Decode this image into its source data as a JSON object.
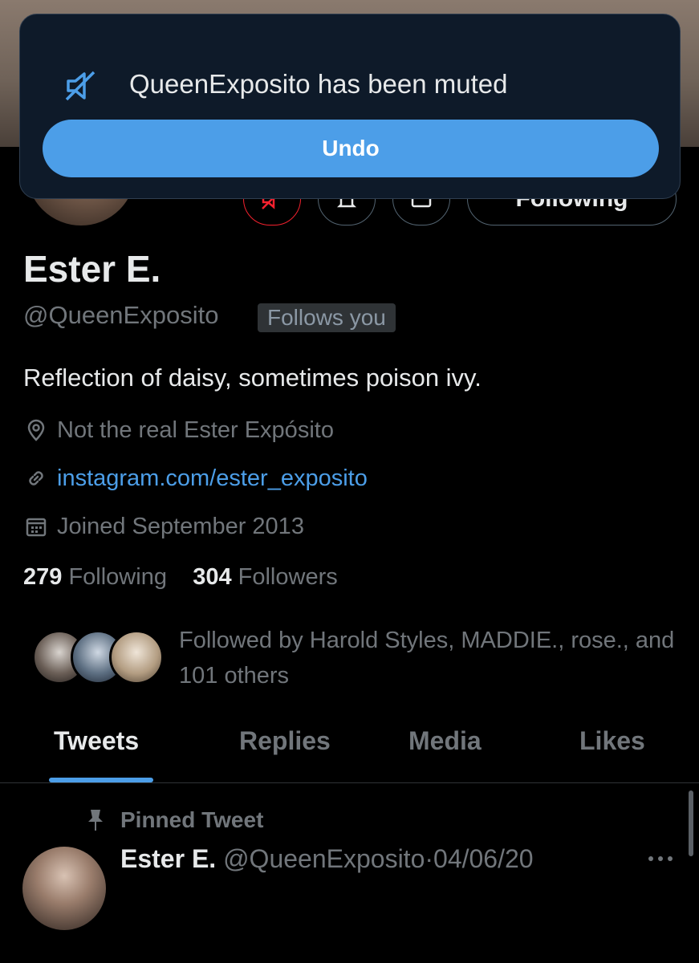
{
  "toast": {
    "icon": "mute-speaker-icon",
    "message": "QueenExposito has been muted",
    "undo_label": "Undo"
  },
  "header": {
    "following_label": "Following",
    "action_icons": [
      "muted-icon",
      "notification-bell-icon",
      "message-icon"
    ]
  },
  "profile": {
    "name": "Ester E.",
    "handle": "@QueenExposito",
    "follows_you": "Follows you",
    "bio": "Reflection of daisy, sometimes poison ivy.",
    "location": "Not the real Ester Expósito",
    "website": "instagram.com/ester_exposito",
    "joined": "Joined September 2013",
    "following_count": "279",
    "following_label": "Following",
    "followers_count": "304",
    "followers_label": "Followers",
    "followed_by": "Followed by Harold Styles, MADDIE., rose., and 101 others"
  },
  "tabs": [
    {
      "label": "Tweets",
      "active": true
    },
    {
      "label": "Replies",
      "active": false
    },
    {
      "label": "Media",
      "active": false
    },
    {
      "label": "Likes",
      "active": false
    }
  ],
  "pinned_tweet": {
    "pinned_label": "Pinned Tweet",
    "name": "Ester E.",
    "handle": "@QueenExposito",
    "separator": "·",
    "date": "04/06/20"
  },
  "colors": {
    "accent": "#4c9ee8",
    "background": "#000000",
    "muted_text": "#71767b",
    "toast_bg": "#0e1a29",
    "mute_red": "#f4212e"
  }
}
